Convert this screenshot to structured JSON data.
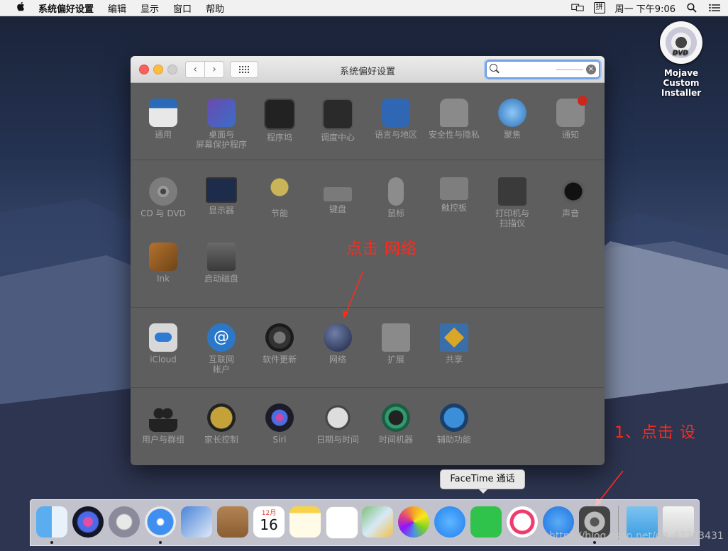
{
  "menubar": {
    "apple": "",
    "items": [
      "系统偏好设置",
      "编辑",
      "显示",
      "窗口",
      "帮助"
    ],
    "clock": "周一 下午9:06",
    "input_method": "拼"
  },
  "desktop": {
    "disk_label_line1": "Mojave Custom",
    "disk_label_line2": "Installer",
    "dvd_text": "DVD"
  },
  "window": {
    "title": "系统偏好设置",
    "nav_back": "‹",
    "nav_forward": "›",
    "search_clear": "×"
  },
  "sections": {
    "row1": [
      {
        "label": "通用",
        "icon": "general-icon"
      },
      {
        "label": "桌面与\n屏幕保护程序",
        "icon": "desktop-screensaver-icon"
      },
      {
        "label": "程序坞",
        "icon": "dock-icon"
      },
      {
        "label": "调度中心",
        "icon": "mission-control-icon"
      },
      {
        "label": "语言与地区",
        "icon": "language-region-icon"
      },
      {
        "label": "安全性与隐私",
        "icon": "security-privacy-icon"
      },
      {
        "label": "聚焦",
        "icon": "spotlight-icon"
      },
      {
        "label": "通知",
        "icon": "notifications-icon"
      }
    ],
    "row2": [
      {
        "label": "CD 与 DVD",
        "icon": "cd-dvd-icon"
      },
      {
        "label": "显示器",
        "icon": "displays-icon"
      },
      {
        "label": "节能",
        "icon": "energy-saver-icon"
      },
      {
        "label": "键盘",
        "icon": "keyboard-icon"
      },
      {
        "label": "鼠标",
        "icon": "mouse-icon"
      },
      {
        "label": "触控板",
        "icon": "trackpad-icon"
      },
      {
        "label": "打印机与\n扫描仪",
        "icon": "printers-scanners-icon"
      },
      {
        "label": "声音",
        "icon": "sound-icon"
      }
    ],
    "row3": [
      {
        "label": "Ink",
        "icon": "ink-icon"
      },
      {
        "label": "启动磁盘",
        "icon": "startup-disk-icon"
      }
    ],
    "row4": [
      {
        "label": "iCloud",
        "icon": "icloud-icon"
      },
      {
        "label": "互联网\n帐户",
        "icon": "internet-accounts-icon"
      },
      {
        "label": "软件更新",
        "icon": "software-update-icon"
      },
      {
        "label": "网络",
        "icon": "network-icon"
      },
      {
        "label": "扩展",
        "icon": "extensions-icon"
      },
      {
        "label": "共享",
        "icon": "sharing-icon"
      }
    ],
    "row5": [
      {
        "label": "用户与群组",
        "icon": "users-groups-icon"
      },
      {
        "label": "家长控制",
        "icon": "parental-controls-icon"
      },
      {
        "label": "Siri",
        "icon": "siri-icon"
      },
      {
        "label": "日期与时间",
        "icon": "date-time-icon"
      },
      {
        "label": "时间机器",
        "icon": "time-machine-icon"
      },
      {
        "label": "辅助功能",
        "icon": "accessibility-icon"
      }
    ]
  },
  "annotations": {
    "network_hint": "点击  网络",
    "settings_hint": "1、点击  设"
  },
  "dock": {
    "tooltip": "FaceTime 通话",
    "calendar_month": "12月",
    "calendar_day": "16"
  },
  "watermark": "https://blog.csdn.net/qq_42703431"
}
